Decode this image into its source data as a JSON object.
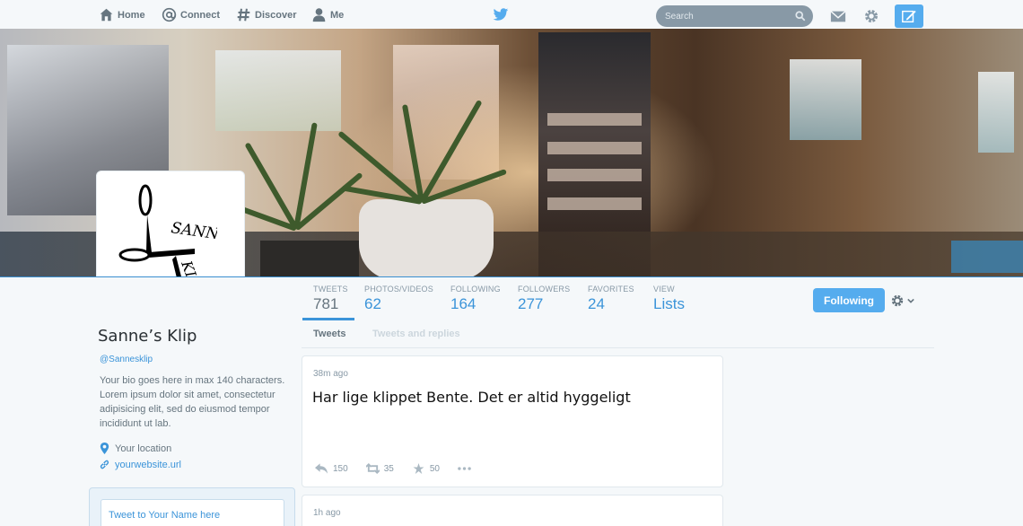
{
  "nav": {
    "home": "Home",
    "connect": "Connect",
    "discover": "Discover",
    "me": "Me",
    "search_placeholder": "Search"
  },
  "profile": {
    "name": "Sanne’s Klip",
    "handle": "@Sannesklip",
    "bio": "Your bio goes here in max 140 characters. Lorem ipsum dolor sit amet, consectetur adipisicing elit, sed do eiusmod tempor incididunt ut lab.",
    "location": "Your location",
    "website": "yourwebsite.url",
    "logo_text": "SANNE'S KLIP"
  },
  "stats": [
    {
      "label": "TWEETS",
      "value": "781"
    },
    {
      "label": "PHOTOS/VIDEOS",
      "value": "62"
    },
    {
      "label": "FOLLOWING",
      "value": "164"
    },
    {
      "label": "FOLLOWERS",
      "value": "277"
    },
    {
      "label": "FAVORITES",
      "value": "24"
    },
    {
      "label": "VIEW",
      "value": "Lists"
    }
  ],
  "follow_button": "Following",
  "timeline": {
    "tabs": [
      "Tweets",
      "Tweets and replies"
    ],
    "tweets": [
      {
        "time": "38m ago",
        "text": "Har lige klippet Bente. Det er altid hyggeligt",
        "replies": "150",
        "retweets": "35",
        "favorites": "50"
      },
      {
        "time": "1h ago"
      }
    ]
  },
  "tweet_box_placeholder": "Tweet to Your Name here",
  "colors": {
    "accent": "#55acee",
    "link": "#3b94d9",
    "background": "#f5f8fa"
  },
  "icons": [
    "home-icon",
    "at-icon",
    "hash-icon",
    "person-icon",
    "twitter-bird-icon",
    "search-icon",
    "mail-icon",
    "gear-icon",
    "compose-icon",
    "location-icon",
    "link-icon",
    "reply-icon",
    "retweet-icon",
    "star-icon",
    "more-icon"
  ]
}
